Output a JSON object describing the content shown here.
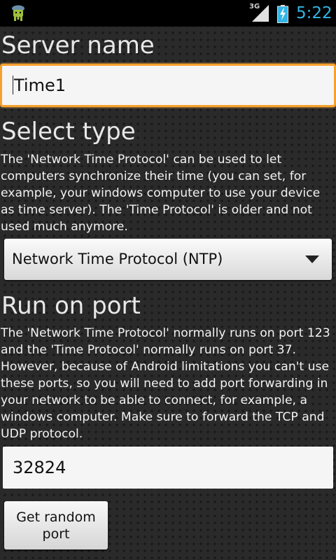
{
  "statusbar": {
    "network_type": "3G",
    "time": "5:22",
    "app_icon": "android-robot-icon",
    "signal_icon": "signal-icon",
    "battery_icon": "battery-charging-icon",
    "time_color": "#33b5e5"
  },
  "server_name": {
    "heading": "Server name",
    "value": "Time1",
    "focus_color": "#f7a02c"
  },
  "select_type": {
    "heading": "Select type",
    "description": "The 'Network Time Protocol' can be used to let computers synchronize their time (you can set, for example, your windows computer to use your device as time server). The 'Time Protocol' is older and not used much anymore.",
    "selected": "Network Time Protocol (NTP)",
    "arrow_icon": "dropdown-arrow-icon"
  },
  "port": {
    "heading": "Run on port",
    "description": "The 'Network Time Protocol' normally runs on port 123 and the 'Time Protocol' normally runs on port 37. However, because of Android limitations you can't use these ports, so you will need to add port forwarding in your network to be able to connect, for example, a windows computer. Make sure to forward the TCP and UDP protocol.",
    "value": "32824",
    "random_button_label": "Get random port"
  }
}
